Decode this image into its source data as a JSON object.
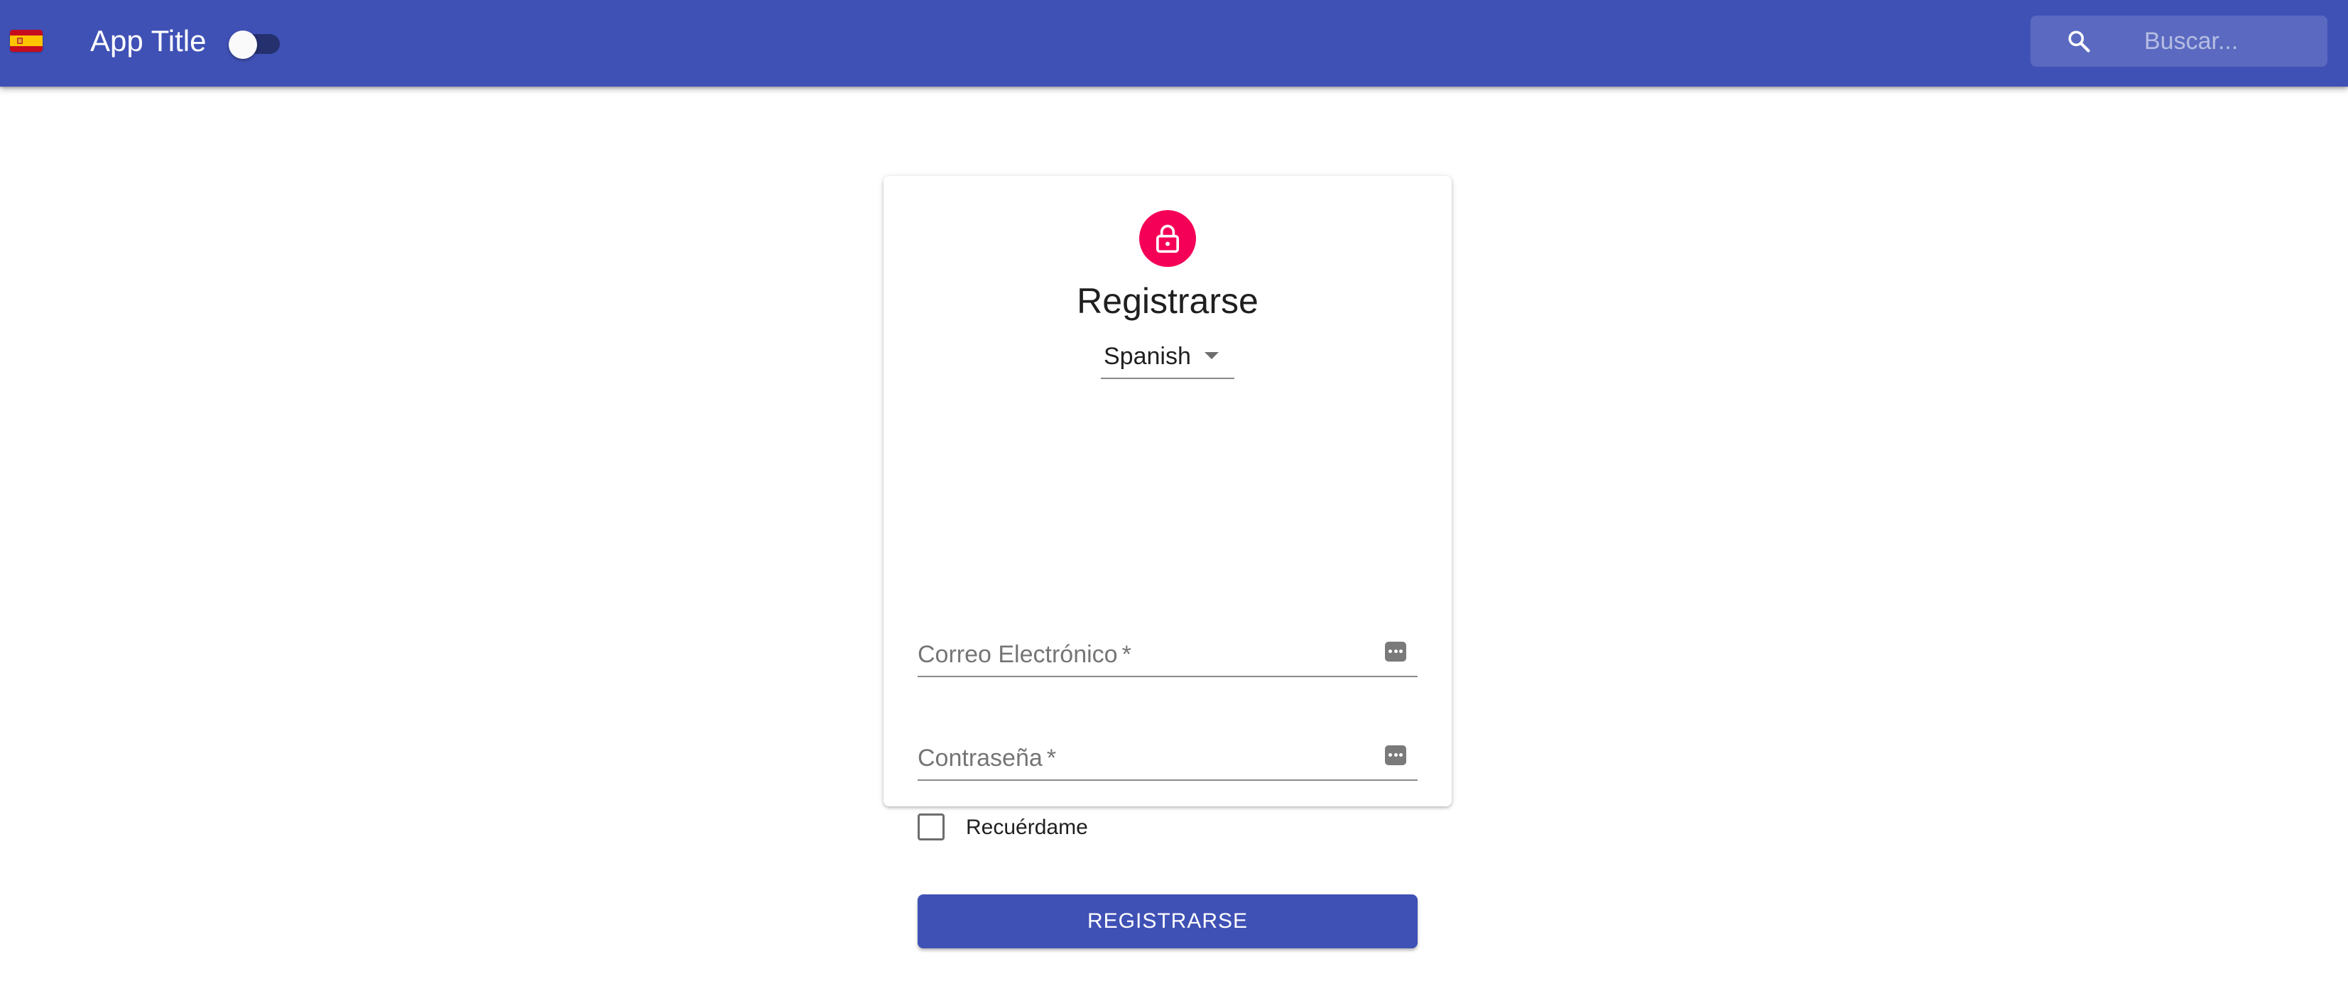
{
  "header": {
    "language_flag": "spain-flag-icon",
    "app_title": "App Title",
    "theme_toggle": {
      "checked": false
    },
    "search": {
      "placeholder": "Buscar...",
      "value": ""
    },
    "colors": {
      "primary": "#3f51b5"
    }
  },
  "signup": {
    "title": "Registrarse",
    "icon": "lock-icon",
    "icon_color": "#f50057",
    "language_select": {
      "selected": "Spanish"
    },
    "email_field": {
      "label": "Correo Electrónico",
      "required_mark": "*",
      "value": ""
    },
    "password_field": {
      "label": "Contraseña",
      "required_mark": "*",
      "value": ""
    },
    "remember_me": {
      "label": "Recuérdame",
      "checked": false
    },
    "submit_label": "Registrarse"
  }
}
